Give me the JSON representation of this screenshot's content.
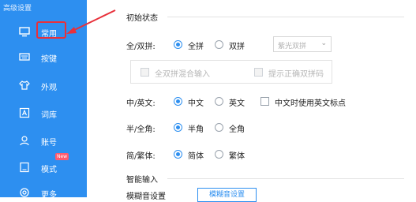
{
  "window": {
    "title": "高级设置"
  },
  "sidebar": {
    "items": [
      {
        "label": "常用",
        "icon": "monitor-icon",
        "selected": true
      },
      {
        "label": "按键",
        "icon": "keyboard-icon"
      },
      {
        "label": "外观",
        "icon": "shirt-icon"
      },
      {
        "label": "词库",
        "icon": "dictionary-icon"
      },
      {
        "label": "账号",
        "icon": "user-icon"
      },
      {
        "label": "模式",
        "icon": "mode-icon",
        "badge": "New"
      },
      {
        "label": "更多",
        "icon": "gear-icon"
      }
    ]
  },
  "content": {
    "section_initial": "初始状态",
    "pinyin": {
      "label": "全/双拼:",
      "options": [
        "全拼",
        "双拼"
      ],
      "selected": "全拼",
      "scheme_select": "紫光双拼",
      "check_mixed": "全双拼混合输入",
      "check_hint": "提示正确双拼码"
    },
    "cn_en": {
      "label": "中/英文:",
      "options": [
        "中文",
        "英文"
      ],
      "selected": "中文",
      "check_punct": "中文时使用英文标点"
    },
    "half_full": {
      "label": "半/全角:",
      "options": [
        "半角",
        "全角"
      ],
      "selected": "半角"
    },
    "simp_trad": {
      "label": "简/繁体:",
      "options": [
        "简体",
        "繁体"
      ],
      "selected": "简体"
    },
    "section_smart": "智能输入",
    "fuzzy": {
      "label": "模糊音设置",
      "button": "模糊音设置"
    }
  },
  "colors": {
    "sidebar": "#2d8ff0",
    "accent": "#2d8ff0",
    "highlight": "#e8303a"
  }
}
